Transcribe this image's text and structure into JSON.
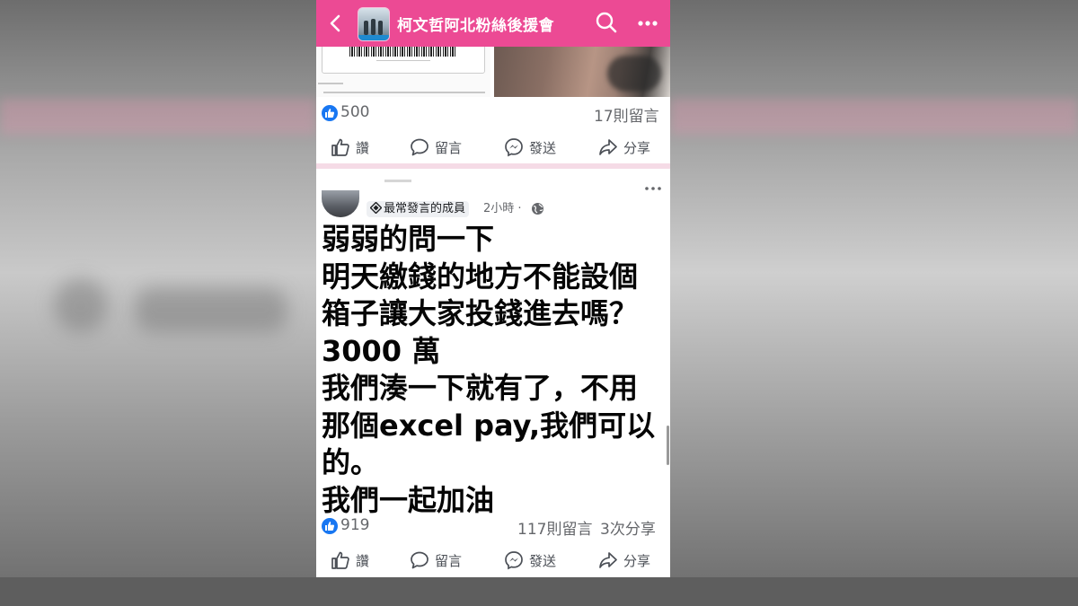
{
  "topbar": {
    "title": "柯文哲阿北粉絲後援會",
    "color": "#ec4a94"
  },
  "post1": {
    "likes": "500",
    "comments": "17則留言"
  },
  "actions": {
    "like": "讚",
    "comment": "留言",
    "send": "發送",
    "share": "分享"
  },
  "post2": {
    "badge": "最常發言的成員",
    "timestamp": "2小時 ·",
    "lines": [
      "弱弱的問一下",
      "明天繳錢的地方不能設個",
      "箱子讓大家投錢進去嗎？",
      "3000 萬",
      "我們湊一下就有了，不用",
      "那個excel pay,我們可以",
      "的。",
      "我們一起加油"
    ],
    "likes": "919",
    "comments": "117則留言",
    "shares": "3次分享"
  },
  "icons": {
    "back": "chevron-left-icon",
    "search": "search-icon",
    "more": "more-horizontal-icon",
    "like": "thumbs-up-icon",
    "comment": "speech-bubble-icon",
    "send": "messenger-icon",
    "share": "share-arrow-icon",
    "globe": "globe-icon"
  },
  "colors": {
    "like_blue": "#1877f2",
    "divider_pink": "#f5dbe6"
  }
}
